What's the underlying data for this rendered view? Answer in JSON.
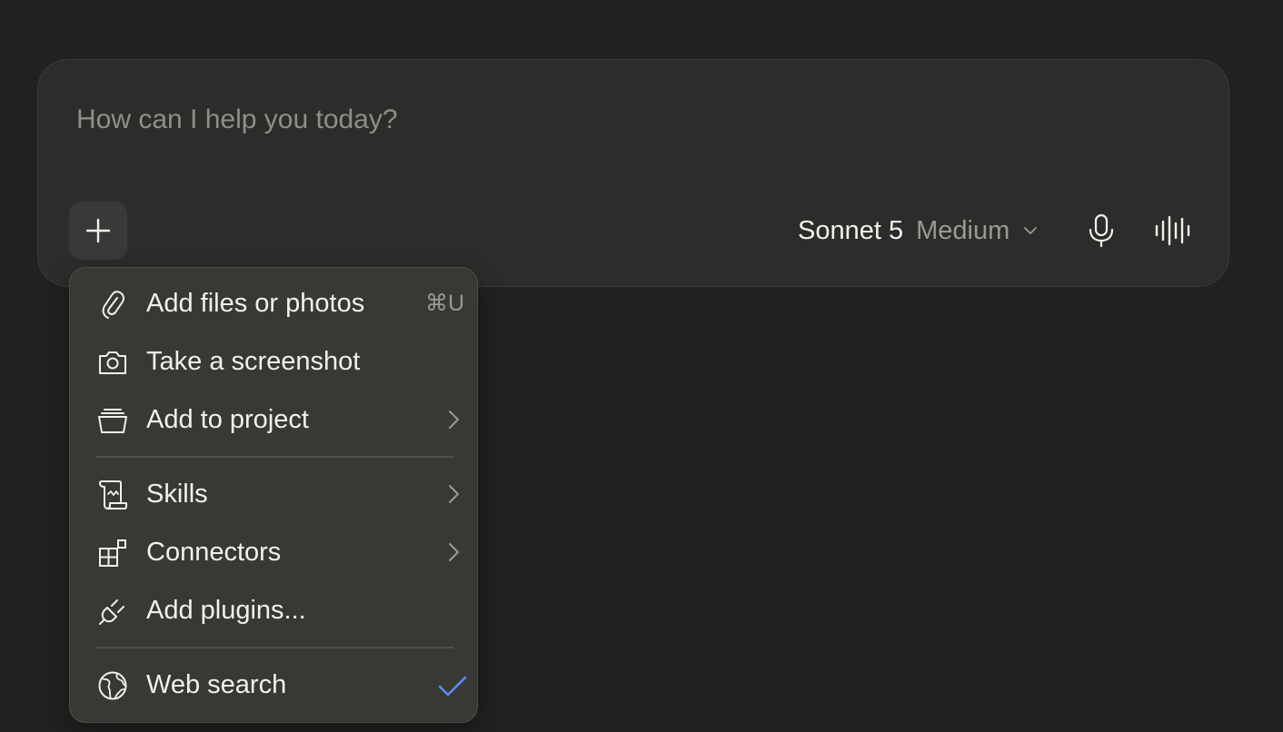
{
  "composer": {
    "placeholder": "How can I help you today?",
    "model_name": "Sonnet 5",
    "model_effort": "Medium"
  },
  "menu": {
    "items": [
      {
        "label": "Add files or photos",
        "shortcut": "⌘U",
        "icon": "paperclip-icon"
      },
      {
        "label": "Take a screenshot",
        "icon": "camera-icon"
      },
      {
        "label": "Add to project",
        "icon": "project-tray-icon",
        "submenu": true
      },
      {
        "label": "Skills",
        "icon": "scroll-icon",
        "submenu": true
      },
      {
        "label": "Connectors",
        "icon": "connectors-grid-icon",
        "submenu": true
      },
      {
        "label": "Add plugins...",
        "icon": "plug-icon"
      },
      {
        "label": "Web search",
        "icon": "globe-icon",
        "checked": true
      }
    ]
  },
  "colors": {
    "background": "#212120",
    "composer": "#2c2c2a",
    "menu": "#383835",
    "check_accent": "#5b8def"
  }
}
